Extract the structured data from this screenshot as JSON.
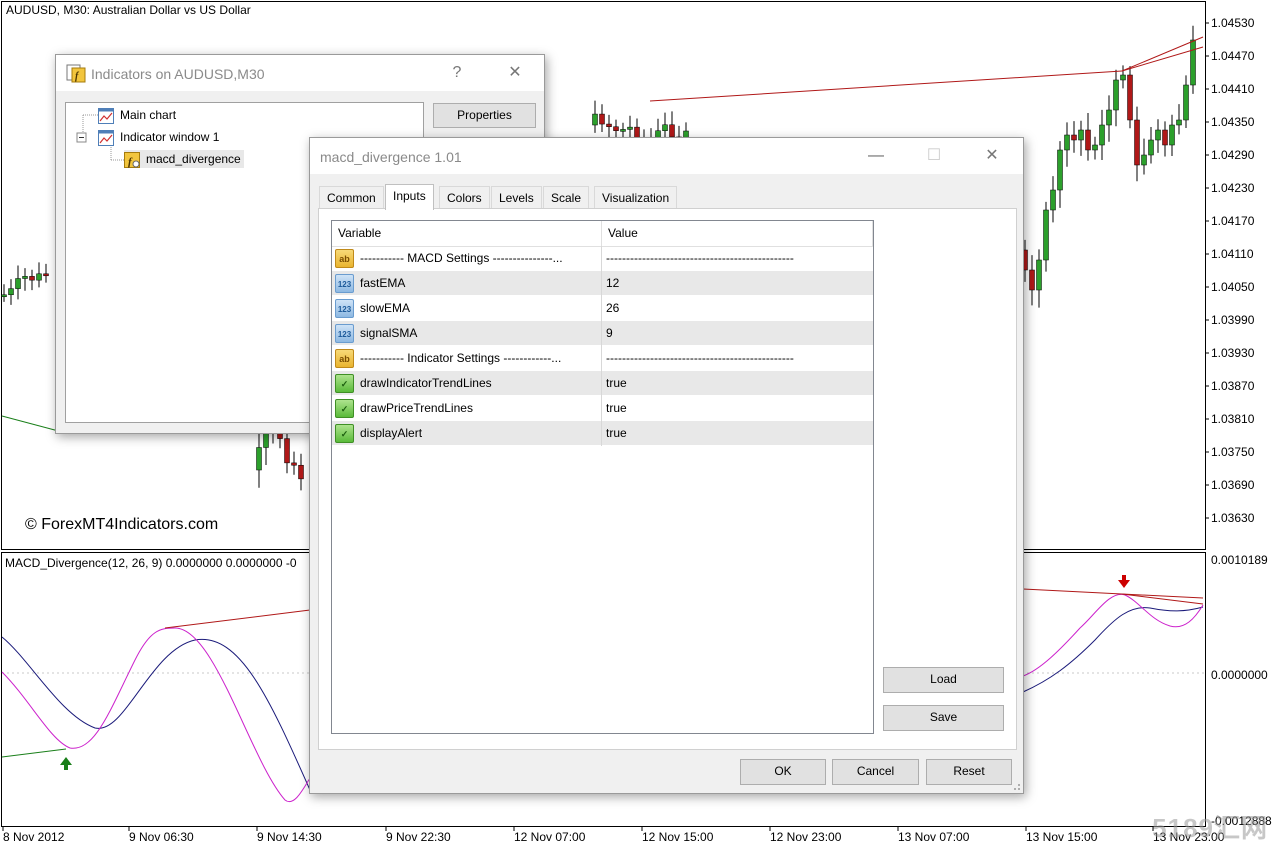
{
  "chart": {
    "title": "AUDUSD, M30:  Australian Dollar vs US Dollar",
    "watermark": "© ForexMT4Indicators.com",
    "indicator_title": "MACD_Divergence(12, 26, 9) 0.0000000 0.0000000 -0",
    "price_labels": [
      "1.04530",
      "1.04470",
      "1.04410",
      "1.04350",
      "1.04290",
      "1.04230",
      "1.04170",
      "1.04110",
      "1.04050",
      "1.03990",
      "1.03930",
      "1.03870",
      "1.03810",
      "1.03750",
      "1.03690",
      "1.03630"
    ],
    "indicator_labels": [
      "0.0010189",
      "0.0000000",
      "-0.0012888"
    ],
    "time_labels": [
      "8 Nov 2012",
      "9 Nov 06:30",
      "9 Nov 14:30",
      "9 Nov 22:30",
      "12 Nov 07:00",
      "12 Nov 15:00",
      "12 Nov 23:00",
      "13 Nov 07:00",
      "13 Nov 15:00",
      "13 Nov 23:00"
    ],
    "site_watermark": "5189汇网",
    "colors": {
      "bull": "#2ca02c",
      "bear": "#b01818",
      "macd_main": "#1a1a7a",
      "macd_signal": "#cc22cc",
      "divergence_bear": "#b01818",
      "divergence_bull": "#1a7f1a",
      "arrow_up": "#1a7f1a",
      "arrow_down": "#cc0000"
    }
  },
  "indicators_dialog": {
    "title": "Indicators on AUDUSD,M30",
    "help_glyph": "?",
    "close_glyph": "✕",
    "tree": [
      {
        "label": "Main chart",
        "icon": "chart-icon"
      },
      {
        "label": "Indicator window 1",
        "icon": "chart-icon"
      },
      {
        "label": "macd_divergence",
        "icon": "custom-indicator-icon"
      }
    ],
    "properties_label": "Properties"
  },
  "props_dialog": {
    "title": "macd_divergence 1.01",
    "minimize_glyph": "—",
    "maximize_glyph": "☐",
    "close_glyph": "✕",
    "tabs": [
      "Common",
      "Inputs",
      "Colors",
      "Levels",
      "Scale",
      "Visualization"
    ],
    "active_tab": "Inputs",
    "columns": [
      "Variable",
      "Value"
    ],
    "rows": [
      {
        "type": "ab",
        "icon_text": "ab",
        "variable": "----------- MACD Settings ---------------...",
        "value": "-----------------------------------------------"
      },
      {
        "type": "num",
        "icon_text": "123",
        "variable": "fastEMA",
        "value": "12"
      },
      {
        "type": "num",
        "icon_text": "123",
        "variable": "slowEMA",
        "value": "26"
      },
      {
        "type": "num",
        "icon_text": "123",
        "variable": "signalSMA",
        "value": "9"
      },
      {
        "type": "ab",
        "icon_text": "ab",
        "variable": "----------- Indicator Settings ------------...",
        "value": "-----------------------------------------------"
      },
      {
        "type": "bool",
        "icon_text": "✓",
        "variable": "drawIndicatorTrendLines",
        "value": "true"
      },
      {
        "type": "bool",
        "icon_text": "✓",
        "variable": "drawPriceTrendLines",
        "value": "true"
      },
      {
        "type": "bool",
        "icon_text": "✓",
        "variable": "displayAlert",
        "value": "true"
      }
    ],
    "load_label": "Load",
    "save_label": "Save",
    "ok_label": "OK",
    "cancel_label": "Cancel",
    "reset_label": "Reset"
  }
}
